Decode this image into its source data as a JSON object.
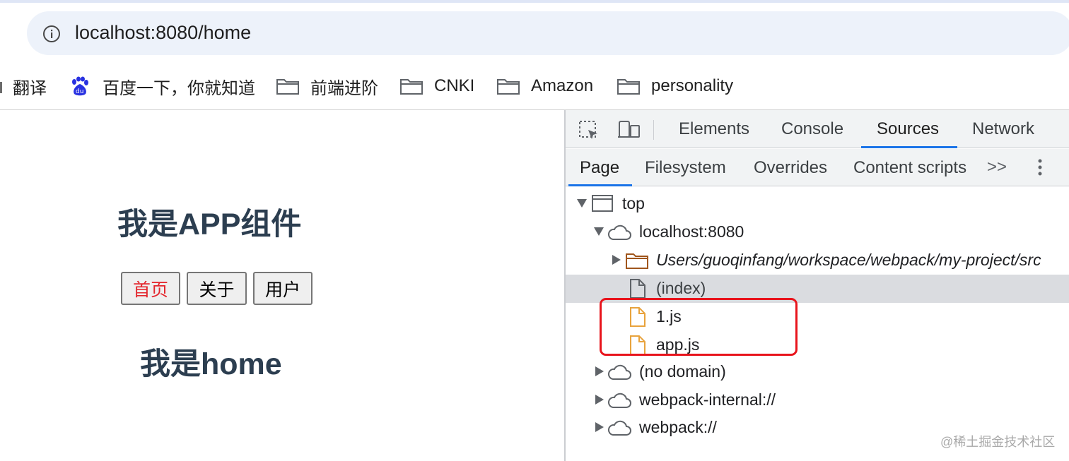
{
  "browser": {
    "url": "localhost:8080/home",
    "bookmarks": [
      {
        "label": "翻译",
        "icon": "translate-icon"
      },
      {
        "label": "百度一下，你就知道",
        "icon": "baidu-paw-icon"
      },
      {
        "label": "前端进阶",
        "icon": "folder-icon"
      },
      {
        "label": "CNKI",
        "icon": "folder-icon"
      },
      {
        "label": "Amazon",
        "icon": "folder-icon"
      },
      {
        "label": "personality",
        "icon": "folder-icon"
      }
    ]
  },
  "page": {
    "title": "我是APP组件",
    "nav": [
      {
        "label": "首页",
        "active": true
      },
      {
        "label": "关于",
        "active": false
      },
      {
        "label": "用户",
        "active": false
      }
    ],
    "subtitle": "我是home"
  },
  "devtools": {
    "tabs": [
      "Elements",
      "Console",
      "Sources",
      "Network"
    ],
    "active_tab": "Sources",
    "sources_tabs": [
      "Page",
      "Filesystem",
      "Overrides",
      "Content scripts"
    ],
    "active_sources_tab": "Page",
    "more_tabs": ">>",
    "tree": [
      {
        "label": "top",
        "icon": "frame-icon",
        "expanded": true
      },
      {
        "label": "localhost:8080",
        "icon": "cloud-icon",
        "expanded": true
      },
      {
        "label": "Users/guoqinfang/workspace/webpack/my-project/src",
        "icon": "folder-icon",
        "expanded": false
      },
      {
        "label": "(index)",
        "icon": "file-icon",
        "selected": true
      },
      {
        "label": "1.js",
        "icon": "js-file-icon"
      },
      {
        "label": "app.js",
        "icon": "js-file-icon"
      },
      {
        "label": "(no domain)",
        "icon": "cloud-icon",
        "expanded": false
      },
      {
        "label": "webpack-internal://",
        "icon": "cloud-icon",
        "expanded": false
      },
      {
        "label": "webpack://",
        "icon": "cloud-icon",
        "expanded": false
      }
    ]
  },
  "colors": {
    "accent": "#1a73e8",
    "highlight": "#e8141c",
    "active_nav": "#e3262d",
    "heading": "#2c3e50",
    "js_file": "#e8a33d",
    "folder": "#a0561d"
  },
  "watermark": "@稀土掘金技术社区"
}
